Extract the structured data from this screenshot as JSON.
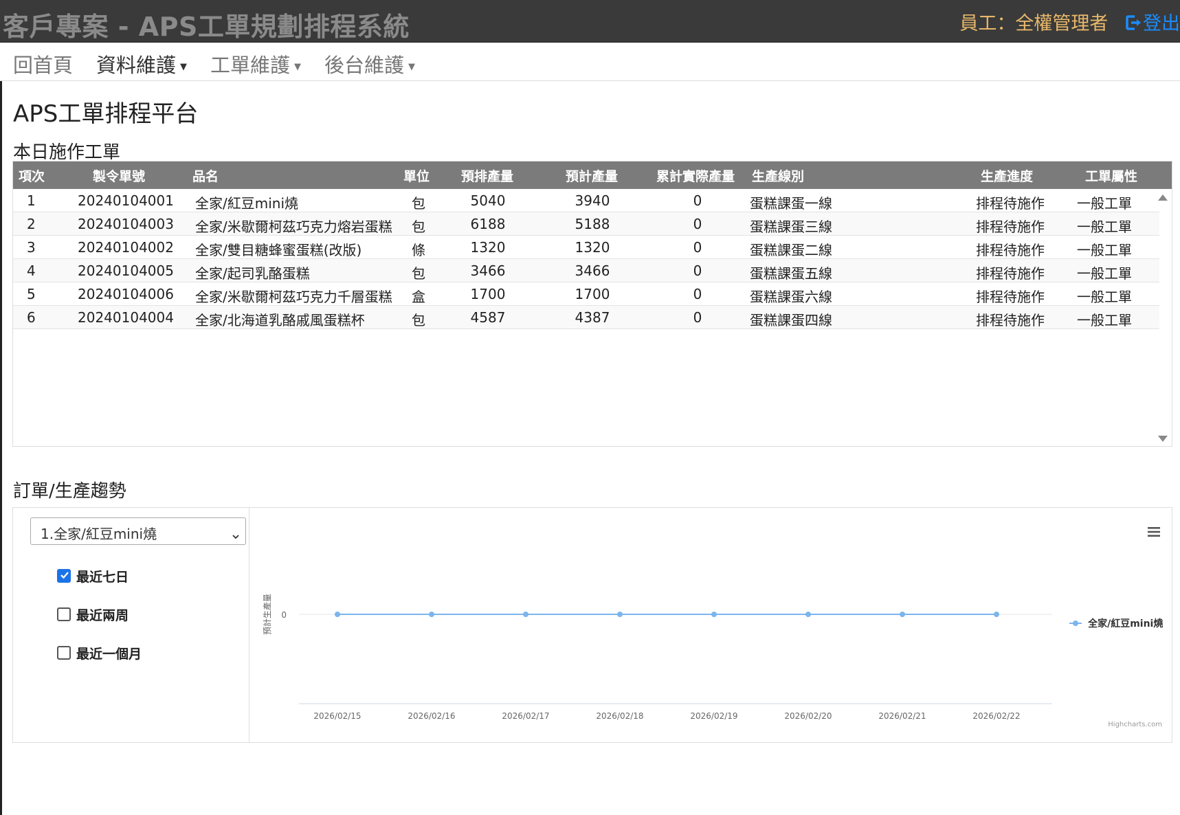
{
  "header": {
    "title": "客戶專案 - APS工單規劃排程系統",
    "user_label": "員工：全權管理者",
    "logout_label": "登出"
  },
  "nav": {
    "items": [
      {
        "label": "回首頁",
        "has_dropdown": false
      },
      {
        "label": "資料維護",
        "has_dropdown": true
      },
      {
        "label": "工單維護",
        "has_dropdown": true
      },
      {
        "label": "後台維護",
        "has_dropdown": true
      }
    ]
  },
  "page": {
    "title": "APS工單排程平台",
    "today_section": "本日施作工單",
    "trend_section": "訂單/生產趨勢"
  },
  "table": {
    "columns": [
      "項次",
      "製令單號",
      "品名",
      "單位",
      "預排產量",
      "預計產量",
      "累計實際產量",
      "生產線別",
      "生產進度",
      "工單屬性"
    ],
    "rows": [
      [
        "1",
        "20240104001",
        "全家/紅豆mini燒",
        "包",
        "5040",
        "3940",
        "0",
        "蛋糕課蛋一線",
        "排程待施作",
        "一般工單"
      ],
      [
        "2",
        "20240104003",
        "全家/米歇爾柯茲巧克力熔岩蛋糕",
        "包",
        "6188",
        "5188",
        "0",
        "蛋糕課蛋三線",
        "排程待施作",
        "一般工單"
      ],
      [
        "3",
        "20240104002",
        "全家/雙目糖蜂蜜蛋糕(改版)",
        "條",
        "1320",
        "1320",
        "0",
        "蛋糕課蛋二線",
        "排程待施作",
        "一般工單"
      ],
      [
        "4",
        "20240104005",
        "全家/起司乳酪蛋糕",
        "包",
        "3466",
        "3466",
        "0",
        "蛋糕課蛋五線",
        "排程待施作",
        "一般工單"
      ],
      [
        "5",
        "20240104006",
        "全家/米歇爾柯茲巧克力千層蛋糕",
        "盒",
        "1700",
        "1700",
        "0",
        "蛋糕課蛋六線",
        "排程待施作",
        "一般工單"
      ],
      [
        "6",
        "20240104004",
        "全家/北海道乳酪戚風蛋糕杯",
        "包",
        "4587",
        "4387",
        "0",
        "蛋糕課蛋四線",
        "排程待施作",
        "一般工單"
      ]
    ]
  },
  "trend": {
    "selected_product": "1.全家/紅豆mini燒",
    "ranges": [
      {
        "label": "最近七日",
        "checked": true
      },
      {
        "label": "最近兩周",
        "checked": false
      },
      {
        "label": "最近一個月",
        "checked": false
      }
    ],
    "credits": "Highcharts.com"
  },
  "colors": {
    "series": "#7cb5ec",
    "header_bg": "#3a3a3a",
    "table_header_bg": "#7b7b7b",
    "user_label": "#e8b86a",
    "logout": "#1a8cff",
    "checkbox": "#1a73e8"
  },
  "chart_data": {
    "type": "line",
    "ylabel": "預計生產量",
    "xlabel": "",
    "categories": [
      "2026/02/15",
      "2026/02/16",
      "2026/02/17",
      "2026/02/18",
      "2026/02/19",
      "2026/02/20",
      "2026/02/21",
      "2026/02/22"
    ],
    "y_ticks": [
      "0"
    ],
    "series": [
      {
        "name": "全家/紅豆mini燒",
        "values": [
          0,
          0,
          0,
          0,
          0,
          0,
          0,
          0
        ]
      }
    ],
    "legend_position": "right",
    "grid": true
  }
}
